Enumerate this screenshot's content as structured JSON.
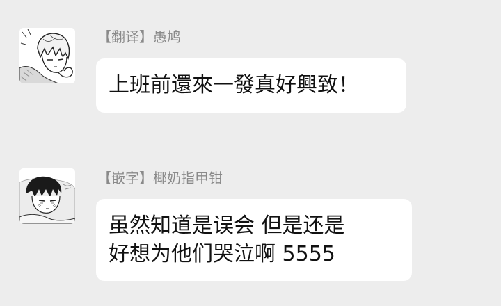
{
  "messages": [
    {
      "avatar_icon": "manga-boy-light-hair-avatar-icon",
      "sender": "【翻译】愚鸠",
      "lines": [
        "上班前還來一發真好興致！"
      ]
    },
    {
      "avatar_icon": "manga-boy-dark-hair-avatar-icon",
      "sender": "【嵌字】椰奶指甲钳",
      "lines": [
        "虽然知道是误会  但是还是",
        "好想为他们哭泣啊 5555"
      ]
    }
  ],
  "colors": {
    "background": "#ededed",
    "bubble": "#ffffff",
    "sender_text": "#8a8a8a",
    "message_text": "#111111"
  }
}
